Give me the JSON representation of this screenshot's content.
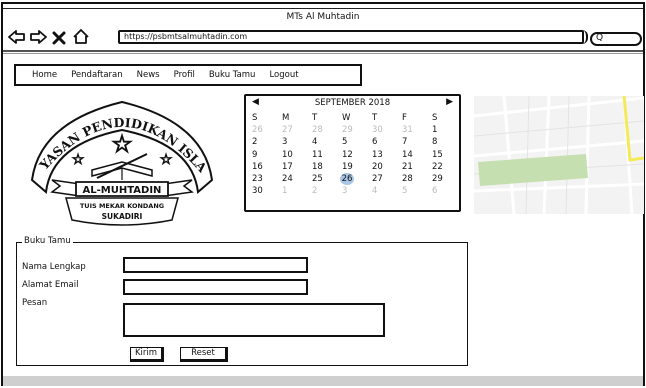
{
  "window": {
    "title": "MTs Al Muhtadin"
  },
  "browser": {
    "url": "https://psbmtsalmuhtadin.com",
    "search_placeholder": "Q",
    "icons": [
      "back-arrow-icon",
      "forward-arrow-icon",
      "close-icon",
      "home-icon"
    ]
  },
  "nav": {
    "items": [
      "Home",
      "Pendaftaran",
      "News",
      "Profil",
      "Buku Tamu",
      "Logout"
    ]
  },
  "logo": {
    "top_text": "YAYASAN PENDIDIKAN ISLAM",
    "ribbon_text": "AL-MUHTADIN",
    "sub_text": "TUIS MEKAR KONDANG",
    "bottom_text": "SUKADIRI"
  },
  "calendar": {
    "month_label": "SEPTEMBER 2018",
    "weekdays": [
      "S",
      "M",
      "T",
      "W",
      "T",
      "F",
      "S"
    ],
    "weeks": [
      [
        {
          "d": "26",
          "m": true
        },
        {
          "d": "27",
          "m": true
        },
        {
          "d": "28",
          "m": true
        },
        {
          "d": "29",
          "m": true
        },
        {
          "d": "30",
          "m": true
        },
        {
          "d": "31",
          "m": true
        },
        {
          "d": "1"
        }
      ],
      [
        {
          "d": "2"
        },
        {
          "d": "3"
        },
        {
          "d": "4"
        },
        {
          "d": "5"
        },
        {
          "d": "6"
        },
        {
          "d": "7"
        },
        {
          "d": "8"
        }
      ],
      [
        {
          "d": "9"
        },
        {
          "d": "10"
        },
        {
          "d": "11"
        },
        {
          "d": "12"
        },
        {
          "d": "13"
        },
        {
          "d": "14"
        },
        {
          "d": "15"
        }
      ],
      [
        {
          "d": "16"
        },
        {
          "d": "17"
        },
        {
          "d": "18"
        },
        {
          "d": "19"
        },
        {
          "d": "20"
        },
        {
          "d": "21"
        },
        {
          "d": "22"
        }
      ],
      [
        {
          "d": "23"
        },
        {
          "d": "24"
        },
        {
          "d": "25"
        },
        {
          "d": "26",
          "sel": true
        },
        {
          "d": "27"
        },
        {
          "d": "28"
        },
        {
          "d": "29"
        }
      ],
      [
        {
          "d": "30"
        },
        {
          "d": "1",
          "m": true
        },
        {
          "d": "2",
          "m": true
        },
        {
          "d": "3",
          "m": true
        },
        {
          "d": "4",
          "m": true
        },
        {
          "d": "5",
          "m": true
        },
        {
          "d": "6",
          "m": true
        }
      ]
    ],
    "selected_color": "#a9c6e6"
  },
  "map": {
    "road_color": "#f5e95a",
    "park_color": "#c6dfb0"
  },
  "guestbook": {
    "legend": "Buku Tamu",
    "name_label": "Nama Lengkap",
    "name_value": "",
    "email_label": "Alamat Email",
    "email_value": "",
    "message_label": "Pesan",
    "message_value": "",
    "submit_label": "Kirim",
    "reset_label": "Reset"
  }
}
